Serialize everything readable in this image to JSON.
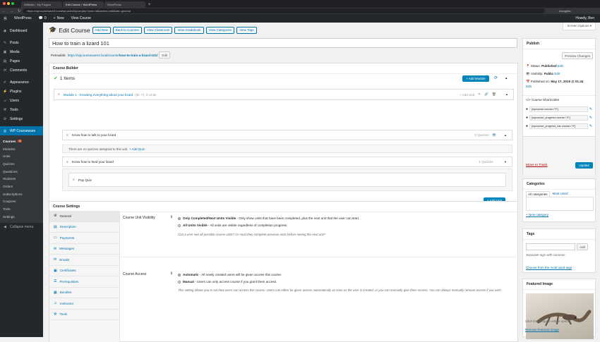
{
  "browser": {
    "tabs": [
      "Affiliates ‹ My Plugins",
      "Edit Course ‹ WordPress",
      "WordPress"
    ],
    "url": "https://wpcourseware3.local/wp-admin/post.php?post=46&action=edit&tab=general",
    "incognito": "Incognito"
  },
  "adminbar": {
    "wp": "WordPress",
    "site": "WP Courseware",
    "comments": "0",
    "new": "New",
    "view": "View Course",
    "howdy": "Howdy, Ben"
  },
  "sidebar": {
    "items": [
      {
        "label": "Dashboard",
        "icon": "dashboard-icon"
      },
      {
        "label": "Posts",
        "icon": "pin-icon"
      },
      {
        "label": "Media",
        "icon": "media-icon"
      },
      {
        "label": "Pages",
        "icon": "page-icon"
      },
      {
        "label": "Comments",
        "icon": "comment-icon"
      },
      {
        "label": "Appearance",
        "icon": "brush-icon"
      },
      {
        "label": "Plugins",
        "icon": "plug-icon"
      },
      {
        "label": "Users",
        "icon": "user-icon"
      },
      {
        "label": "Tools",
        "icon": "wrench-icon"
      },
      {
        "label": "Settings",
        "icon": "settings-icon"
      }
    ],
    "active": "WP Courseware",
    "sub": [
      "Courses",
      "Modules",
      "Units",
      "Quizzes",
      "Questions",
      "Students",
      "Orders",
      "Subscriptions",
      "Coupons",
      "Tools",
      "Settings"
    ],
    "courses_badge": "1",
    "collapse": "Collapse menu"
  },
  "header": {
    "title": "Edit Course",
    "buttons": [
      "Add New",
      "Back to Courses",
      "View Classroom",
      "View Gradebook",
      "View Categories",
      "View Tags"
    ],
    "screen_options": "Screen Options ▾"
  },
  "post": {
    "title": "How to train a lizard 101",
    "permalink_label": "Permalink:",
    "permalink_base": "https://wpcourseware3.local/course/",
    "permalink_slug": "how-to-train-a-lizard-101/",
    "edit": "Edit"
  },
  "builder": {
    "title": "Course Builder",
    "items": "1 Items",
    "add_module": "+ Add Module",
    "module": {
      "title": "Module 1 - Knowing everything about your lizard",
      "id": "(ID: 7)",
      "units": "2 Units",
      "add_unit": "+ Add Unit"
    },
    "units": [
      {
        "title": "Know how to talk to your lizard",
        "quizzes": "0 Quizzes",
        "note": "There are no quizzes assigned to this unit.",
        "add_quiz": "+ Add Quiz"
      },
      {
        "title": "Know how to feed your lizard",
        "quizzes": "1 Quizzes",
        "quiz": "Pop Quiz"
      }
    ],
    "add_unit_btn": "+ Add Unit"
  },
  "settings": {
    "title": "Course Settings",
    "tabs": [
      "General",
      "Description",
      "Payments",
      "Messages",
      "Emails",
      "Certificates",
      "Prerequisites",
      "Bundles",
      "Instructor",
      "Tools"
    ],
    "visibility": {
      "label": "Course Unit Visibility",
      "opt1_b": "Only Completed/Next Units Visible",
      "opt1": " - Only show units that have been completed, plus the next unit that the user can start.",
      "opt2_b": "All Units Visible",
      "opt2": " - All units are visible regardless of completion progress.",
      "desc": "Can a user see all possible course units? Or must they complete previous units before seeing the next unit?"
    },
    "access": {
      "label": "Course Access",
      "opt1_b": "Automatic",
      "opt1": " - All newly created users will be given access this course.",
      "opt2_b": "Manual",
      "opt2": " - Users can only access course if you grant them access.",
      "desc": "This setting allows you to set how users can access this course. Users can either be given access automatically as soon as the user is created, or you can manually give them access. You can always manually remove access if you wish."
    }
  },
  "publish": {
    "title": "Publish",
    "preview": "Preview Changes",
    "status_label": "Status:",
    "status": "Published",
    "visibility_label": "Visibility:",
    "visibility": "Public",
    "published_label": "Published on:",
    "published": "May 17, 2019 @ 01:44",
    "edit": "Edit",
    "shortcodes": "Course Shortcodes",
    "codes": [
      "[wpcourse course=\"9\"]",
      "[wpcourse_progress course=\"9\"]",
      "[wpcourse_progress_bar course=\"9\"]"
    ],
    "trash": "Move to Trash",
    "update": "Update"
  },
  "categories": {
    "title": "Categories",
    "tab_all": "All categories",
    "tab_used": "Most Used",
    "new": "+ New category"
  },
  "tags": {
    "title": "Tags",
    "add": "Add",
    "hint": "Separate tags with commas",
    "choose": "Choose from the most used tags"
  },
  "featured": {
    "title": "Featured Image",
    "hint": "Click the image to edit or update",
    "remove": "Remove featured image"
  }
}
